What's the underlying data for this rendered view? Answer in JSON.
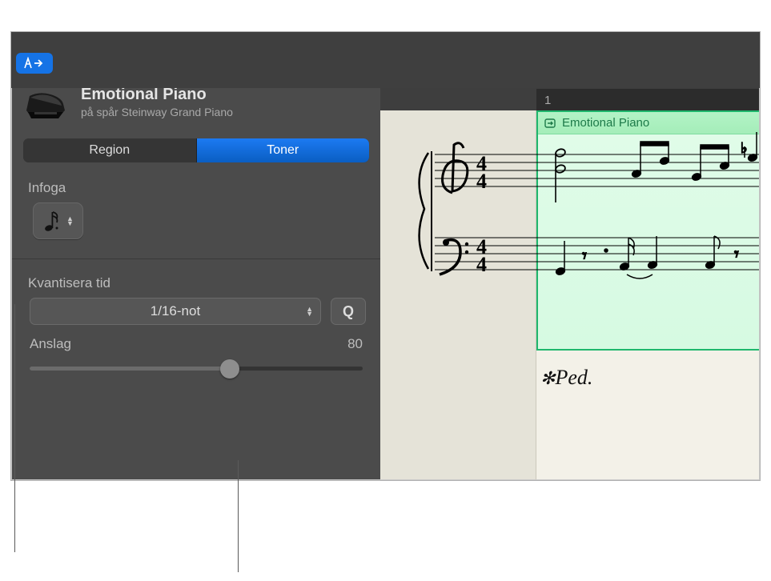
{
  "toolbar": {
    "filter_icon": "filter"
  },
  "header": {
    "title": "Emotional Piano",
    "subtitle": "på spår Steinway Grand Piano"
  },
  "segments": {
    "region": "Region",
    "notes": "Toner"
  },
  "insert": {
    "label": "Infoga",
    "note_value": "sixteenth-note"
  },
  "quantize": {
    "label": "Kvantisera tid",
    "value": "1/16-not",
    "button": "Q"
  },
  "velocity": {
    "label": "Anslag",
    "value": "80",
    "percent": 60
  },
  "ruler": {
    "bar": "1"
  },
  "region": {
    "name": "Emotional Piano"
  },
  "pedal": "*Ped.",
  "chart_data": {
    "type": "score",
    "time_signature": "4/4",
    "clefs": [
      "treble",
      "bass"
    ],
    "notes_visible": true
  }
}
